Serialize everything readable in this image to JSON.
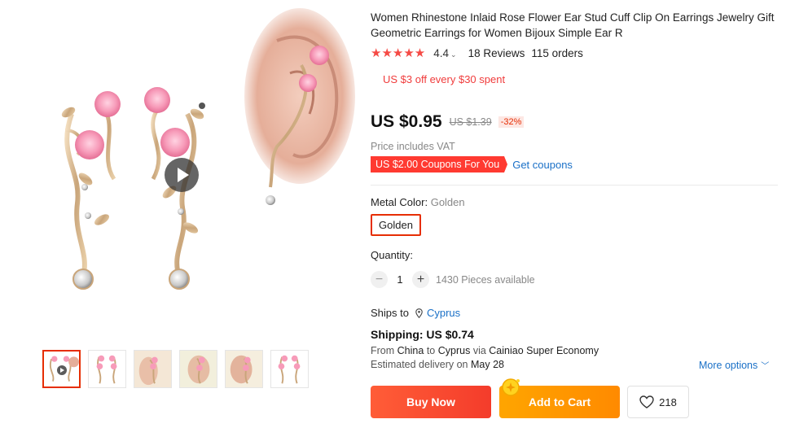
{
  "product": {
    "title": "Women Rhinestone Inlaid Rose Flower Ear Stud Cuff Clip On Earrings Jewelry Gift Geometric Earrings for Women Bijoux Simple Ear R",
    "stars": "★★★★★",
    "rating": "4.4",
    "reviews": "18 Reviews",
    "orders": "115 orders",
    "promo": "US $3 off every $30 spent"
  },
  "price": {
    "current": "US $0.95",
    "original": "US $1.39",
    "discount": "-32%",
    "vat_note": "Price includes VAT",
    "coupon": "US $2.00 Coupons For You",
    "get_coupons": "Get coupons"
  },
  "sku": {
    "label": "Metal Color:",
    "selected": "Golden",
    "option": "Golden"
  },
  "quantity": {
    "label": "Quantity:",
    "minus": "−",
    "plus": "+",
    "value": "1",
    "available": "1430 Pieces available"
  },
  "shipping": {
    "ships_to_label": "Ships to",
    "country": "Cyprus",
    "cost": "Shipping: US $0.74",
    "from_prefix": "From",
    "from": "China",
    "to_prefix": "to",
    "to": "Cyprus",
    "via_prefix": "via",
    "method": "Cainiao Super Economy",
    "est_prefix": "Estimated delivery on",
    "est_date": "May 28",
    "more_options": "More options"
  },
  "actions": {
    "buy_now": "Buy Now",
    "add_to_cart": "Add to Cart",
    "wishlist_count": "218"
  },
  "colors": {
    "accent_red": "#e62e04",
    "buy_now": "#f43c2b",
    "add_to_cart": "#ff9900",
    "link_blue": "#1a70c7",
    "star": "#f54a45"
  },
  "gallery": {
    "thumbnail_count": 6,
    "active_index": 0
  }
}
